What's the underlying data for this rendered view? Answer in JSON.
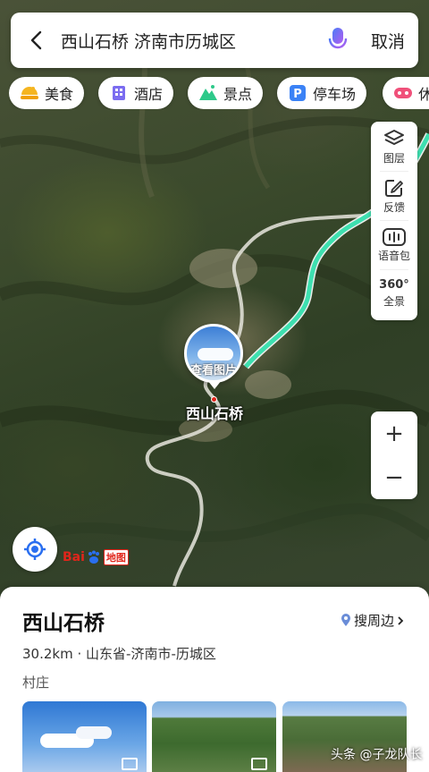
{
  "search": {
    "query": "西山石桥 济南市历城区",
    "cancel_label": "取消"
  },
  "categories": [
    {
      "label": "美食",
      "icon": "food-icon"
    },
    {
      "label": "酒店",
      "icon": "hotel-icon"
    },
    {
      "label": "景点",
      "icon": "scenic-icon"
    },
    {
      "label": "停车场",
      "icon": "parking-icon"
    },
    {
      "label": "休",
      "icon": "leisure-icon"
    }
  ],
  "tools": [
    {
      "label": "图层",
      "icon": "layers-icon"
    },
    {
      "label": "反馈",
      "icon": "feedback-icon"
    },
    {
      "label": "语音包",
      "icon": "voice-pack-icon"
    },
    {
      "label": "全景",
      "icon": "panorama-icon",
      "badge": "360°"
    }
  ],
  "zoom": {
    "in_label": "+",
    "out_label": "−"
  },
  "map": {
    "marker_label": "查看图片",
    "poi_name": "西山石桥",
    "logo": {
      "left": "Bai",
      "right": "地图"
    }
  },
  "place": {
    "name": "西山石桥",
    "nearby_label": "搜周边",
    "distance": "30.2km",
    "separator": "·",
    "region": "山东省-济南市-历城区",
    "type": "村庄"
  },
  "watermark": "头条 @子龙队长",
  "colors": {
    "route": "#3ee0b0",
    "accent_red": "#e1251b",
    "locate_blue": "#2a6ff0"
  }
}
